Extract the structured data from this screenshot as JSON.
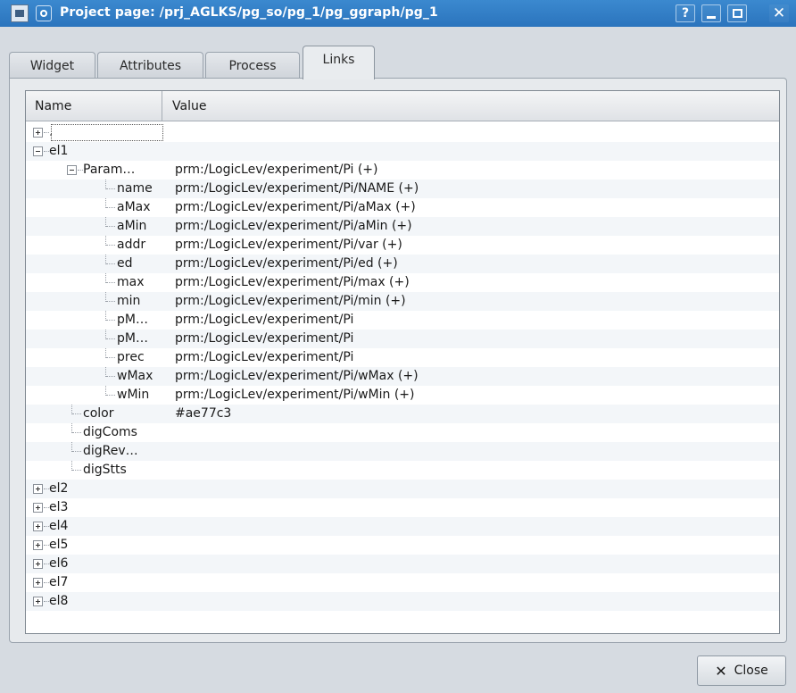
{
  "window": {
    "title": "Project page: /prj_AGLKS/pg_so/pg_1/pg_ggraph/pg_1",
    "help_label": "?",
    "close_label": "✕"
  },
  "tabs": [
    {
      "label": "Widget",
      "active": false
    },
    {
      "label": "Attributes",
      "active": false
    },
    {
      "label": "Process",
      "active": false
    },
    {
      "label": "Links",
      "active": true
    }
  ],
  "tree": {
    "columns": [
      "Name",
      "Value"
    ],
    "rows": [
      {
        "name": ".",
        "value": ""
      },
      {
        "name": "el1",
        "value": ""
      },
      {
        "name": "Param…",
        "value": "prm:/LogicLev/experiment/Pi (+)"
      },
      {
        "name": "name",
        "value": "prm:/LogicLev/experiment/Pi/NAME (+)"
      },
      {
        "name": "aMax",
        "value": "prm:/LogicLev/experiment/Pi/aMax (+)"
      },
      {
        "name": "aMin",
        "value": "prm:/LogicLev/experiment/Pi/aMin (+)"
      },
      {
        "name": "addr",
        "value": "prm:/LogicLev/experiment/Pi/var (+)"
      },
      {
        "name": "ed",
        "value": "prm:/LogicLev/experiment/Pi/ed (+)"
      },
      {
        "name": "max",
        "value": "prm:/LogicLev/experiment/Pi/max (+)"
      },
      {
        "name": "min",
        "value": "prm:/LogicLev/experiment/Pi/min (+)"
      },
      {
        "name": "pM…",
        "value": "prm:/LogicLev/experiment/Pi"
      },
      {
        "name": "pM…",
        "value": "prm:/LogicLev/experiment/Pi"
      },
      {
        "name": "prec",
        "value": "prm:/LogicLev/experiment/Pi"
      },
      {
        "name": "wMax",
        "value": "prm:/LogicLev/experiment/Pi/wMax (+)"
      },
      {
        "name": "wMin",
        "value": "prm:/LogicLev/experiment/Pi/wMin (+)"
      },
      {
        "name": "color",
        "value": "#ae77c3"
      },
      {
        "name": "digComs",
        "value": ""
      },
      {
        "name": "digRev…",
        "value": ""
      },
      {
        "name": "digStts",
        "value": ""
      },
      {
        "name": "el2",
        "value": ""
      },
      {
        "name": "el3",
        "value": ""
      },
      {
        "name": "el4",
        "value": ""
      },
      {
        "name": "el5",
        "value": ""
      },
      {
        "name": "el6",
        "value": ""
      },
      {
        "name": "el7",
        "value": ""
      },
      {
        "name": "el8",
        "value": ""
      }
    ]
  },
  "footer": {
    "close_icon": "x-icon",
    "close_label": "Close"
  }
}
